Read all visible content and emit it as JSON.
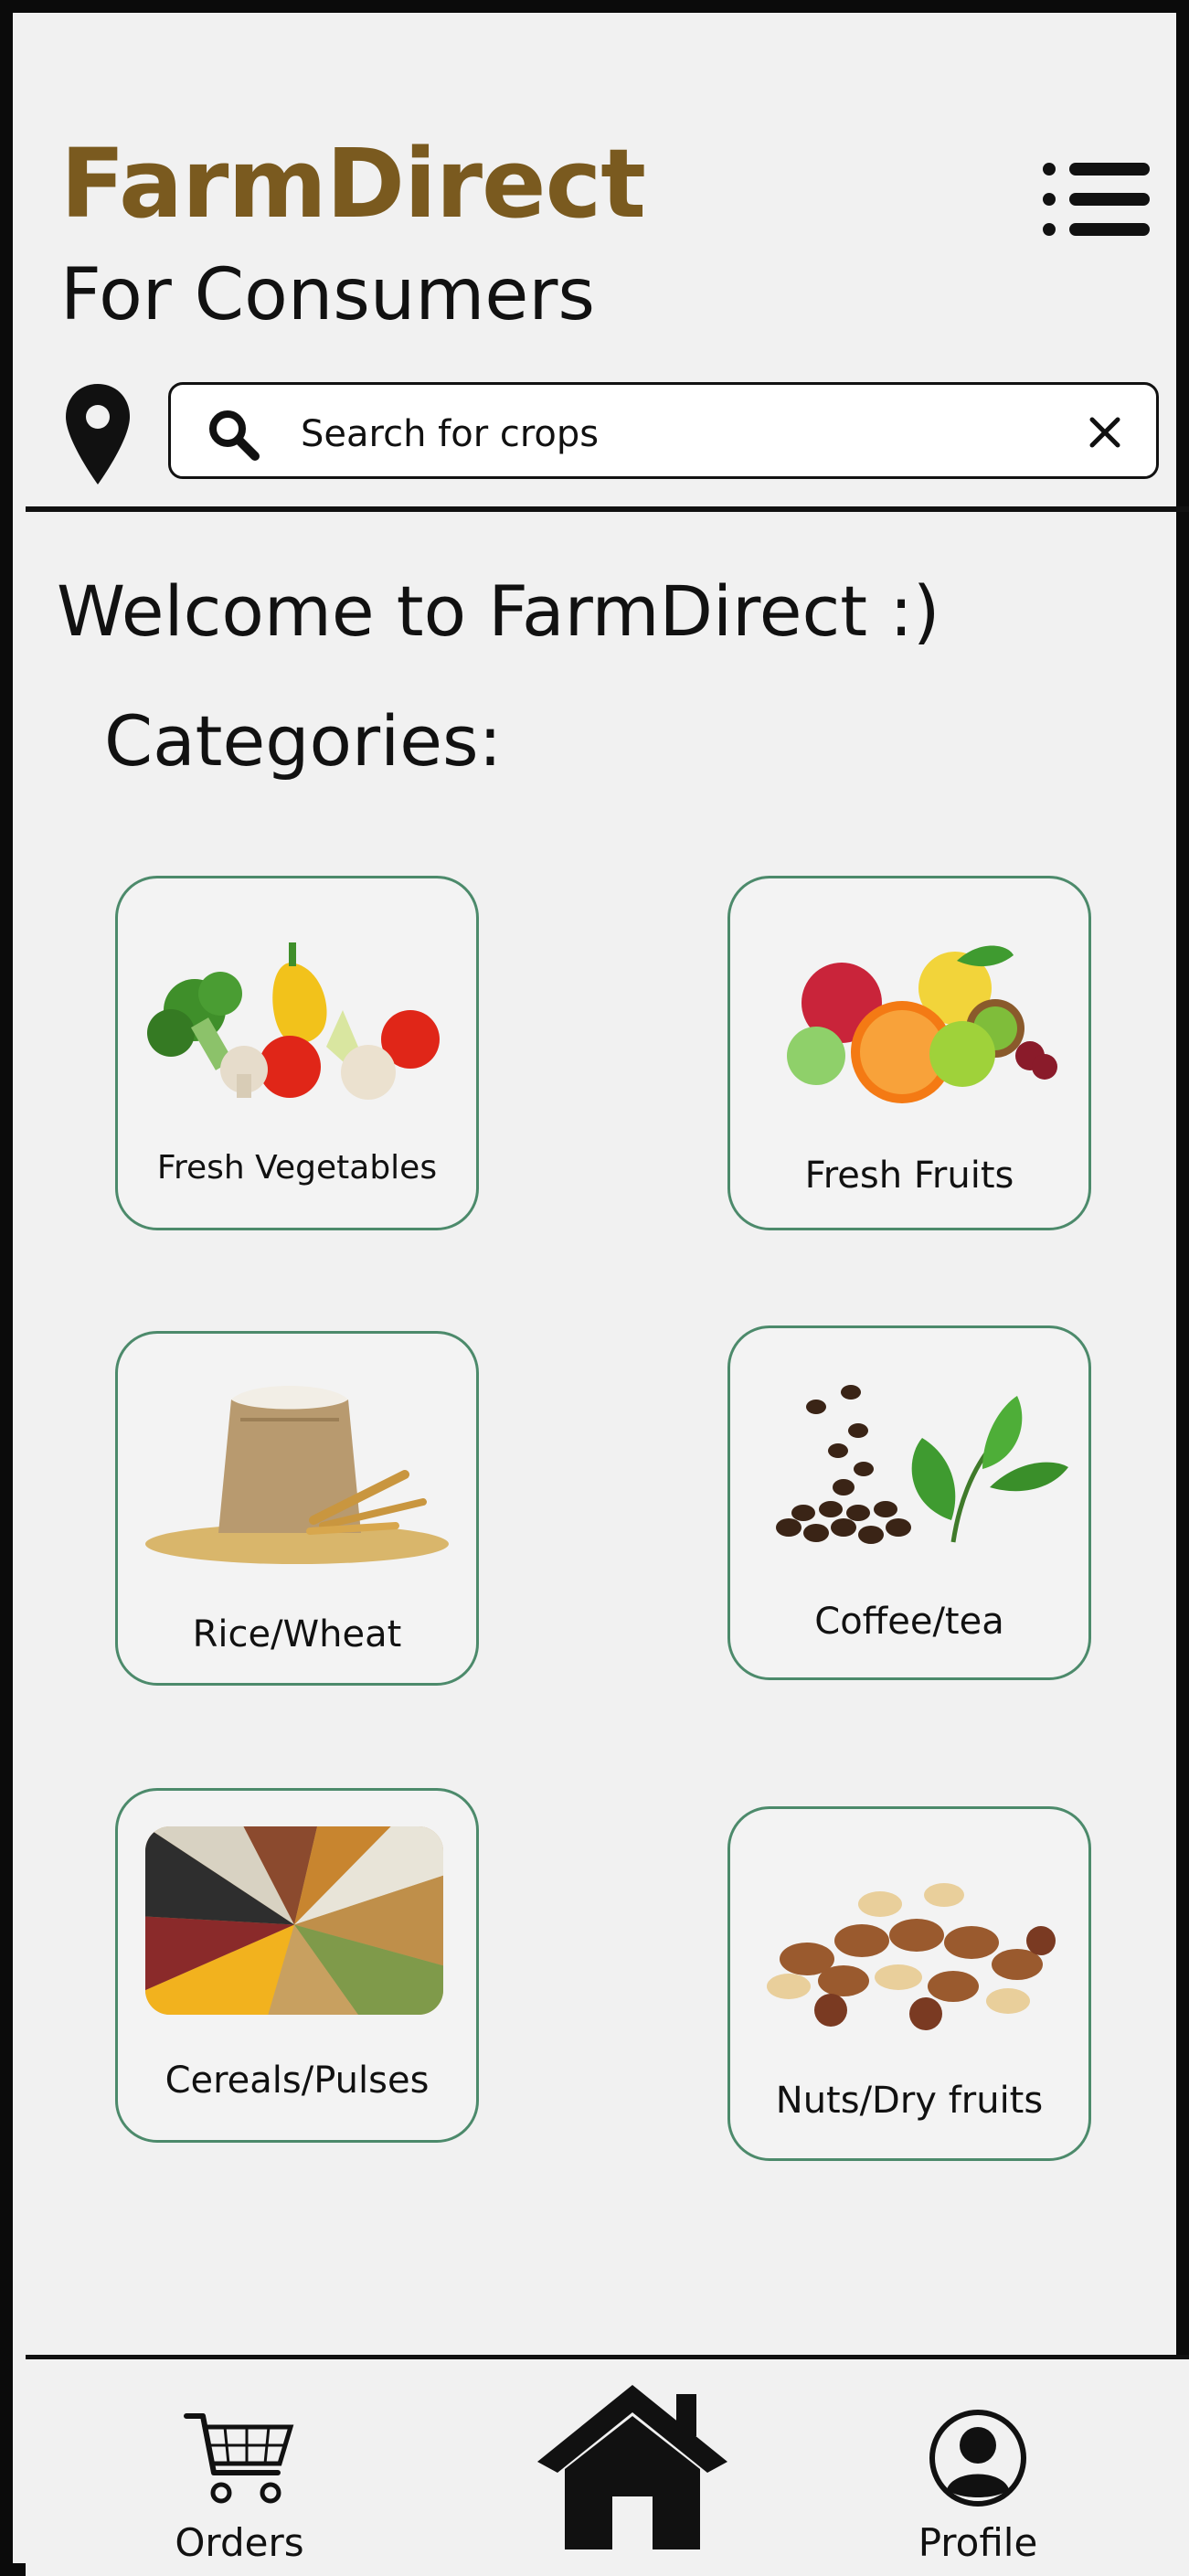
{
  "app": {
    "brand": "FarmDirect",
    "subtitle": "For Consumers"
  },
  "search": {
    "placeholder": "Search for crops"
  },
  "main": {
    "welcome": "Welcome to FarmDirect :)",
    "categories_title": "Categories:",
    "categories": [
      {
        "label": "Fresh Vegetables",
        "icon": "vegetables-image"
      },
      {
        "label": "Fresh Fruits",
        "icon": "fruits-image"
      },
      {
        "label": "Rice/Wheat",
        "icon": "grain-sack-image"
      },
      {
        "label": "Coffee/tea",
        "icon": "coffee-tea-image"
      },
      {
        "label": "Cereals/Pulses",
        "icon": "cereals-pulses-image"
      },
      {
        "label": "Nuts/Dry fruits",
        "icon": "nuts-image"
      }
    ]
  },
  "nav": {
    "orders_label": "Orders",
    "home_icon": "home-icon",
    "profile_label": "Profile"
  },
  "colors": {
    "brand": "#7a5a1f",
    "card_border": "#4c8a6b",
    "background": "#f1f1f1"
  }
}
